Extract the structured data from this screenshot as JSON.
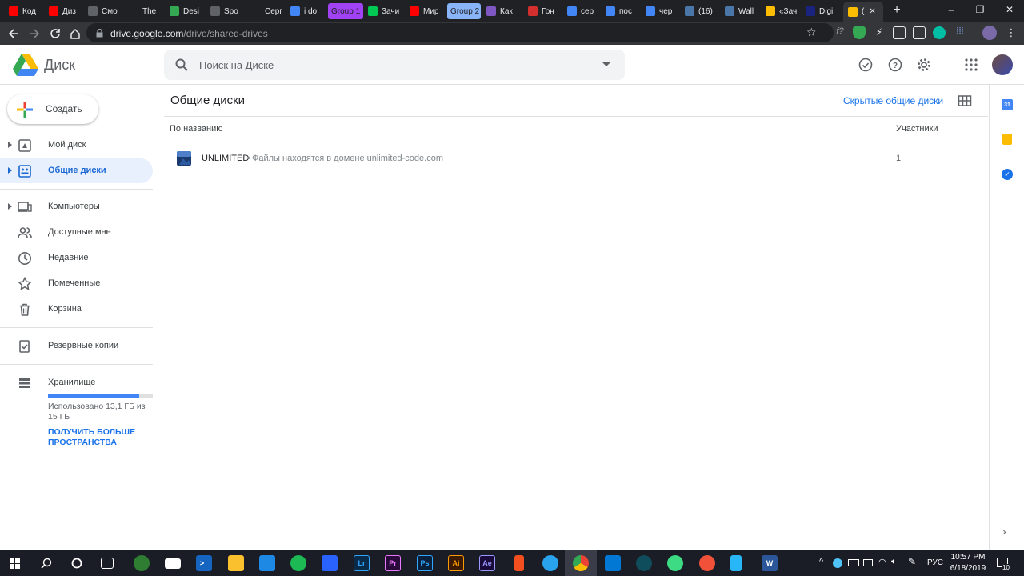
{
  "browser": {
    "tabs": [
      {
        "label": "Код",
        "color": "#ff0000"
      },
      {
        "label": "Диз",
        "color": "#ff0000"
      },
      {
        "label": "Смо",
        "color": "#5f6368"
      },
      {
        "label": "The",
        "color": "#202124"
      },
      {
        "label": "Desi",
        "color": "#34a853"
      },
      {
        "label": "Spo",
        "color": "#5f6368"
      },
      {
        "label": "Серг",
        "color": "#202124"
      },
      {
        "label": "i do",
        "color": "#4285f4"
      },
      {
        "label": "Group 1",
        "color": "#a142f4"
      },
      {
        "label": "Зачи",
        "color": "#00c853"
      },
      {
        "label": "Мир",
        "color": "#ff0000"
      },
      {
        "label": "Group 2",
        "color": "#8ab4f8"
      },
      {
        "label": "Как",
        "color": "#7e57c2"
      },
      {
        "label": "Гон",
        "color": "#d32f2f"
      },
      {
        "label": "сер",
        "color": "#4285f4"
      },
      {
        "label": "пос",
        "color": "#4285f4"
      },
      {
        "label": "чер",
        "color": "#4285f4"
      },
      {
        "label": "(16)",
        "color": "#4a76a8"
      },
      {
        "label": "Wall",
        "color": "#4a76a8"
      },
      {
        "label": "«Зач",
        "color": "#fbbc04"
      },
      {
        "label": "Digi",
        "color": "#1a237e"
      },
      {
        "label": "(",
        "color": "#fbbc04"
      }
    ],
    "url_host": "drive.google.com",
    "url_path": "/drive/shared-drives"
  },
  "header": {
    "title": "Диск",
    "search_placeholder": "Поиск на Диске"
  },
  "sidebar": {
    "create_label": "Создать",
    "items": [
      {
        "label": "Мой диск",
        "icon": "my-drive-icon"
      },
      {
        "label": "Общие диски",
        "icon": "shared-drives-icon"
      },
      {
        "label": "Компьютеры",
        "icon": "computers-icon"
      },
      {
        "label": "Доступные мне",
        "icon": "shared-with-me-icon"
      },
      {
        "label": "Недавние",
        "icon": "clock-icon"
      },
      {
        "label": "Помеченные",
        "icon": "star-icon"
      },
      {
        "label": "Корзина",
        "icon": "trash-icon"
      },
      {
        "label": "Резервные копии",
        "icon": "backups-icon"
      },
      {
        "label": "Хранилище",
        "icon": "storage-icon"
      }
    ],
    "storage": {
      "used_text": "Использовано 13,1 ГБ из 15 ГБ",
      "used_fraction": 0.873,
      "more_link": "ПОЛУЧИТЬ БОЛЬШЕ ПРОСТРАНСТВА"
    }
  },
  "main": {
    "title": "Общие диски",
    "hidden_link": "Скрытые общие диски",
    "columns": {
      "name": "По названию",
      "members": "Участники"
    },
    "rows": [
      {
        "name": "UNLIMITED",
        "separator": "•",
        "description": "Файлы находятся в домене unlimited-code.com",
        "members": "1"
      }
    ]
  },
  "taskbar": {
    "language": "РУС",
    "time": "10:57 PM",
    "date": "6/18/2019",
    "notification_count": "10",
    "apps": [
      {
        "label": "Lr",
        "color": "#0a2a4a"
      },
      {
        "label": "Pr",
        "color": "#2a0a3a"
      },
      {
        "label": "Ps",
        "color": "#0a1f3a"
      },
      {
        "label": "Ai",
        "color": "#3a1a00"
      },
      {
        "label": "Ae",
        "color": "#1a0a3a"
      }
    ]
  },
  "colors": {
    "accent": "#1a73e8",
    "active_bg": "#e8f0fe"
  }
}
